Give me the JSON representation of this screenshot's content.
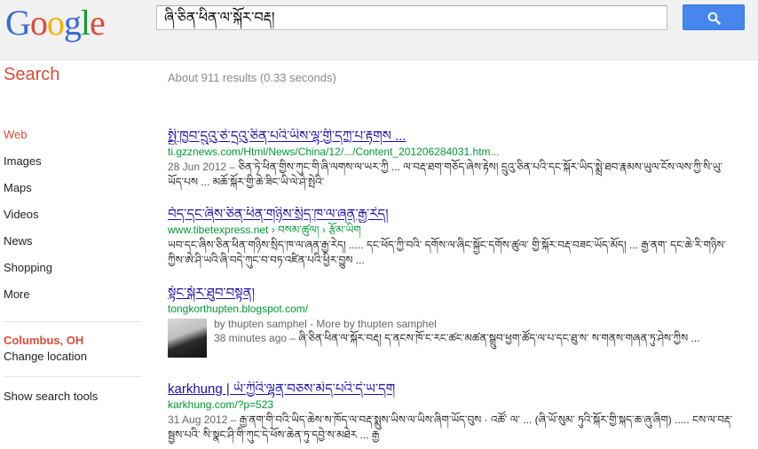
{
  "header": {
    "logo": [
      "G",
      "o",
      "o",
      "g",
      "l",
      "e"
    ],
    "logo_colors": [
      "#3a6bd6",
      "#dd4b39",
      "#f2b400",
      "#3a6bd6",
      "#1a9b3c",
      "#dd4b39"
    ],
    "query": "ཞི་ཅིན་ཕིན་ལ་སྐོར་བརྡ།",
    "search_button_icon": "search-icon"
  },
  "subheader": {
    "title": "Search",
    "stats": "About 911 results (0.33 seconds)"
  },
  "nav": {
    "items": [
      "Web",
      "Images",
      "Maps",
      "Videos",
      "News",
      "Shopping",
      "More"
    ],
    "location_title": "Columbus, OH",
    "change_location": "Change location",
    "show_tools": "Show search tools"
  },
  "results": [
    {
      "title": "སྤྱི་ཁྱབ་དྲུའུ་ཅེ་དྲའུ་ཅིན་པའི་ཡིས་ལྷ་གྱི་དཀྲ་པ་རྟགས ...",
      "url": "ti.gzznews.com/Html/News/China/12/.../Content_201206284031.htm...",
      "meta": "28 Jun 2012 – ",
      "snippet": "ཅིན་ཏེ་ཕིན་གྱིས་ཀུང་གི་ཞི་ལགས་ལ་ཡར་ཀྱི ... ལ་བརྡ་ཐག་གཅོད་ཞེས་རྟེས། དྲུའུ་ཅིན་པའི་དང་སྐོར་ཡིད་སྨྲེ་ཐབ་རྣམས་ཡུལ་ངོས་ལས་ཀྱི་སི་ཡུ་ཡོད་པས ... མཆོ་སྐོར་གྱི་ཆེ་ཟིང་ཡི་ལེ་ཤེ་སྤེའི་"
    },
    {
      "title": "བོད་དང་ཞིས་ཅིན་ཕིན་གཉིས་སྲིད་ཁ་ལ་ཞན་རྒྱ་རེད།",
      "url": "www.tibetexpress.net › བསམ་ཚུལ། › རྩོམ་ཡིག",
      "meta": "",
      "snippet": "ཡབ་དང་ཞིས་ཅིན་ཕིན་གཉིས་སྲིད་ཁ་ལ་ཞན་རྒྱ་རེད། ..... དང་ཕོད་ཀྱི་བའི་ དགོས་ལ་ཞིང་སྐྱོང་དགོས་ཚུལ་ གྱི་སྐོར་བརྡ་བཟང་ཡོད་མོད། ... རྒྱ་ནག་ དང་ཆེ་རི་གཉིས་ཀྱིས་ཨེ་ཤི་ཡའི་ཞི་བདེ་ཀུང་བ་བཏ་འཛིན་པའི་ཕྱིར་བྱུས ..."
    },
    {
      "title": "སྟོང་སྐོར་ཐུབ་བསྟན།",
      "url": "tongkorthupten.blogspot.com/",
      "author": "by thupten samphel",
      "author_more": " - More by thupten samphel",
      "meta": "38 minutes ago – ",
      "snippet": "ཞི་ཅིན་ཕིན་ལ་སྐོར་བརྡ། ད་ནངས་ཁོ་ང་རང་ཚང་མཚན་སྒྲུབ་ཕྱག་ཚོད་ལ་པ་དང་ཐུ་ས་ ས་གནས་གཞན་ཏུ་ཤེས་ཀྱིས ..."
    },
    {
      "title": "karkhung | ཡོ་ཀྱིའི་ལྷན་བཅས་མེད་པའི་དེ་ཡ་དག",
      "url": "karkhung.com/?p=523",
      "meta": "31 Aug 2012 – ",
      "snippet": "རྒྱ་ནག་གི་བའི་ཡིད་ཆེས་ས་ཁོད་ལ་བརྡ་སྨུས་ཡིས་ལ་ཡིས་ཞིག་ཡོད་བུས · འཚོ་ ལ་ ... (ཞི་ཡོ་སུམ་ ཏུའི་སྐོར་གྱི་སྐད་ཆ་ཞུ་ཞིག) ..... ངས་ལ་བརྡ་སྦྱས་པའི་ སི་སྣང་ཤི་གི་ཀུང་དེ་ཕོས་ཆེན་ཏུ་དབྱེ་ས་མཐེར ... རྒྱ"
    }
  ]
}
